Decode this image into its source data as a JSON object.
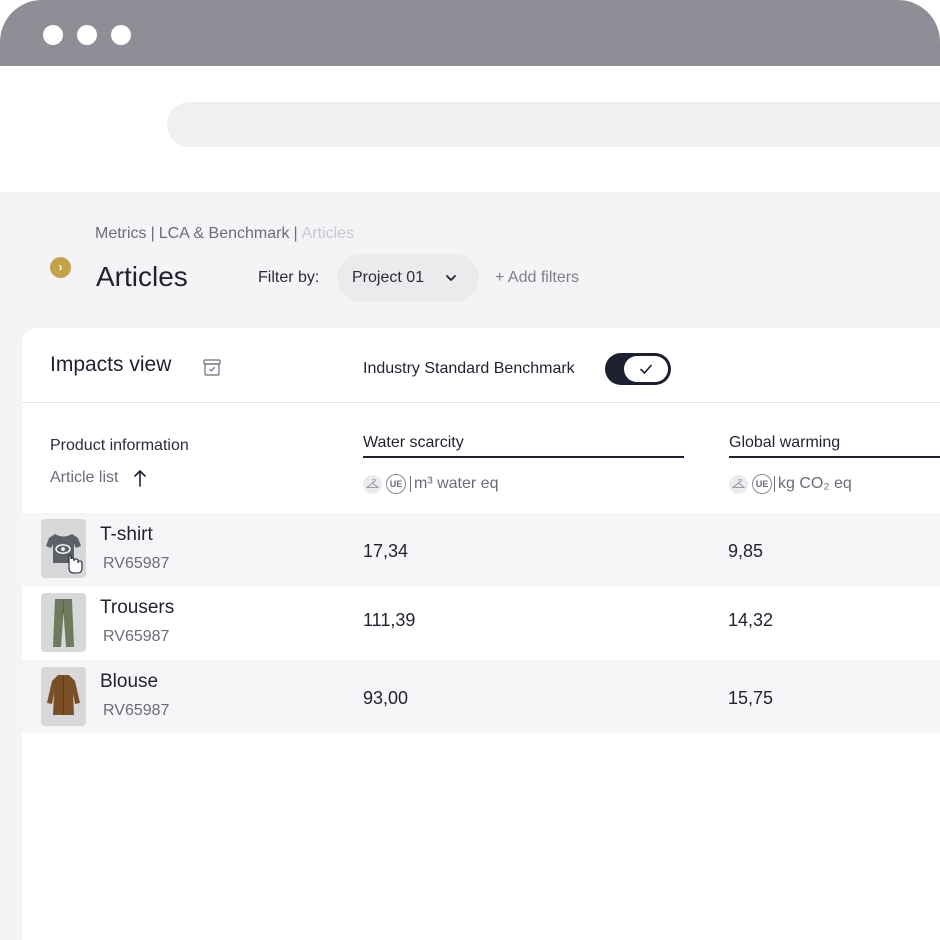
{
  "window": {
    "dots": [
      "window-dot-1",
      "window-dot-2",
      "window-dot-3"
    ]
  },
  "breadcrumb": {
    "items": [
      "Metrics",
      "LCA & Benchmark"
    ],
    "separator": "|",
    "current": "Articles"
  },
  "page": {
    "title": "Articles"
  },
  "filter": {
    "label": "Filter by:",
    "selected": "Project 01",
    "add_label": "+ Add filters"
  },
  "card": {
    "title": "Impacts view",
    "benchmark_label": "Industry Standard Benchmark",
    "benchmark_enabled": true
  },
  "table": {
    "product_header": "Product information",
    "article_list_label": "Article list",
    "sort_direction": "ascending",
    "metrics": [
      {
        "name": "Water scarcity",
        "badge": "UE",
        "unit": "m³ water eq"
      },
      {
        "name": "Global warming",
        "badge": "UE",
        "unit": "kg CO₂ eq"
      }
    ],
    "rows": [
      {
        "name": "T-shirt",
        "code": "RV65987",
        "values": [
          "17,34",
          "9,85"
        ],
        "image": "tshirt-image"
      },
      {
        "name": "Trousers",
        "code": "RV65987",
        "values": [
          "111,39",
          "14,32"
        ],
        "image": "trousers-image"
      },
      {
        "name": "Blouse",
        "code": "RV65987",
        "values": [
          "93,00",
          "15,75"
        ],
        "image": "blouse-image"
      }
    ]
  },
  "colors": {
    "titlebar": "#8e8e96",
    "accent_gold": "#c4a24a",
    "toggle_dark": "#1d2030",
    "page_bg": "#f4f4f6"
  }
}
